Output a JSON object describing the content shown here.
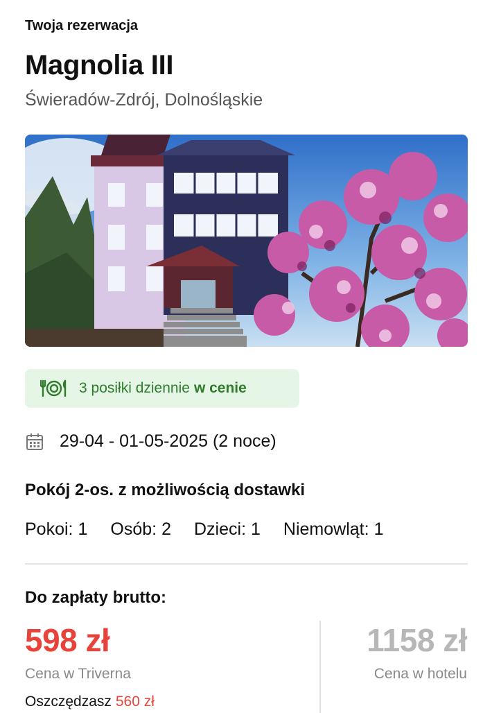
{
  "header": {
    "section_label": "Twoja rezerwacja",
    "hotel_name": "Magnolia III",
    "location": "Świeradów-Zdrój, Dolnośląskie"
  },
  "meals": {
    "icon": "meal-plate-icon",
    "text": "3 posiłki dziennie",
    "strong": "w cenie",
    "background": "#e6f6e6",
    "color": "#2f7d2b"
  },
  "stay": {
    "icon": "calendar-icon",
    "dates": "29-04 - 01-05-2025 (2 noce)"
  },
  "room": {
    "type": "Pokój 2-os. z możliwością dostawki",
    "occupancy": [
      {
        "label": "Pokoi:",
        "value": "1"
      },
      {
        "label": "Osób:",
        "value": "2"
      },
      {
        "label": "Dzieci:",
        "value": "1"
      },
      {
        "label": "Niemowląt:",
        "value": "1"
      }
    ]
  },
  "payment": {
    "label": "Do zapłaty brutto:",
    "price": "598 zł",
    "price_caption": "Cena w Triverna",
    "savings_label": "Oszczędzasz",
    "savings_amount": "560 zł",
    "hotel_price": "1158 zł",
    "hotel_price_caption": "Cena w hotelu",
    "accent_color": "#e8433a"
  }
}
